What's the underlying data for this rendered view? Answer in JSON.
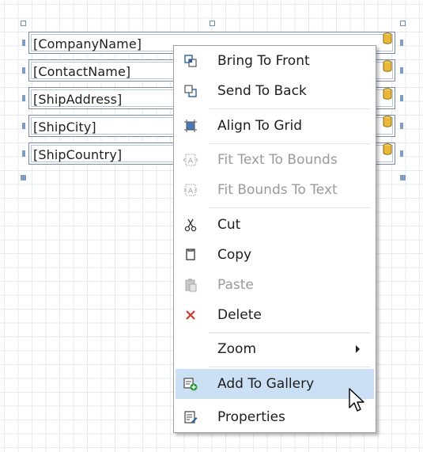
{
  "designer": {
    "fields": [
      {
        "label": "[CompanyName]"
      },
      {
        "label": "[ContactName]"
      },
      {
        "label": "[ShipAddress]"
      },
      {
        "label": "[ShipCity]"
      },
      {
        "label": "[ShipCountry]"
      }
    ]
  },
  "context_menu": {
    "items": [
      {
        "label": "Bring To Front",
        "icon": "bring-to-front-icon",
        "enabled": true
      },
      {
        "label": "Send To Back",
        "icon": "send-to-back-icon",
        "enabled": true
      },
      {
        "label": "Align To Grid",
        "icon": "align-to-grid-icon",
        "enabled": true
      },
      {
        "label": "Fit Text To Bounds",
        "icon": "fit-text-to-bounds-icon",
        "enabled": false
      },
      {
        "label": "Fit Bounds To Text",
        "icon": "fit-bounds-to-text-icon",
        "enabled": false
      },
      {
        "label": "Cut",
        "icon": "cut-icon",
        "enabled": true
      },
      {
        "label": "Copy",
        "icon": "copy-icon",
        "enabled": true
      },
      {
        "label": "Paste",
        "icon": "paste-icon",
        "enabled": false
      },
      {
        "label": "Delete",
        "icon": "delete-icon",
        "enabled": true
      },
      {
        "label": "Zoom",
        "icon": "",
        "enabled": true,
        "submenu": true
      },
      {
        "label": "Add To Gallery",
        "icon": "add-to-gallery-icon",
        "enabled": true,
        "highlighted": true
      },
      {
        "label": "Properties",
        "icon": "properties-icon",
        "enabled": true
      }
    ]
  },
  "colors": {
    "grid_line": "#e6eaf0",
    "selection_handle": "#7f9cc5",
    "menu_highlight": "#cce0f5",
    "delete_red": "#d03a2b",
    "db_icon_gold": "#e8b83a"
  }
}
